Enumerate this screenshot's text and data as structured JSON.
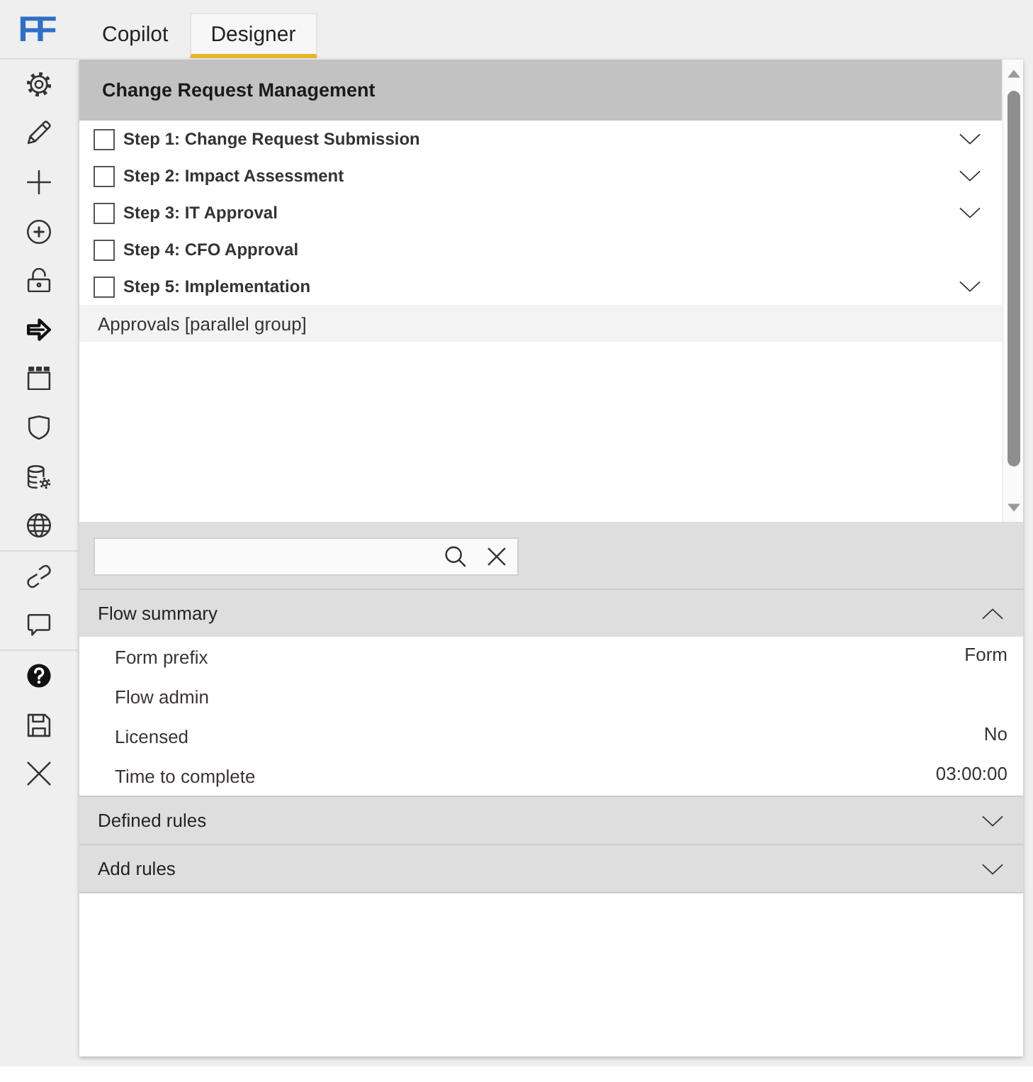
{
  "logo": "FF",
  "sidebar": {
    "groups": [
      {
        "items": [
          {
            "kind": "gear"
          },
          {
            "kind": "pencil"
          },
          {
            "kind": "plus"
          },
          {
            "kind": "plus-circle"
          },
          {
            "kind": "lock"
          },
          {
            "kind": "arrow"
          },
          {
            "kind": "window"
          },
          {
            "kind": "shield"
          },
          {
            "kind": "database"
          },
          {
            "kind": "globe"
          }
        ]
      },
      {
        "items": [
          {
            "kind": "link"
          },
          {
            "kind": "comment"
          }
        ]
      },
      {
        "items": [
          {
            "kind": "help"
          },
          {
            "kind": "save"
          },
          {
            "kind": "close"
          }
        ]
      }
    ]
  },
  "tabs": [
    {
      "label": "Copilot",
      "selected": false
    },
    {
      "label": "Designer",
      "selected": true
    }
  ],
  "flow": {
    "title": "Change Request Management",
    "steps": [
      {
        "label": "Step 1: Change Request Submission",
        "checked": false,
        "expandable": true
      },
      {
        "label": "Step 2: Impact Assessment",
        "checked": false,
        "expandable": true
      },
      {
        "label": "Step 3: IT Approval",
        "checked": false,
        "expandable": true
      },
      {
        "label": "Step 4: CFO Approval",
        "checked": false,
        "expandable": false
      },
      {
        "label": "Step 5: Implementation",
        "checked": false,
        "expandable": true
      }
    ],
    "group": "Approvals [parallel group]"
  },
  "sections": [
    {
      "title": "Flow summary",
      "expanded": true,
      "properties": [
        {
          "label": "Form prefix",
          "value": "Form"
        },
        {
          "label": "Flow admin"
        },
        {
          "label": "Licensed",
          "value": "No"
        },
        {
          "label": "Time to complete",
          "value": "03:00:00"
        }
      ]
    },
    {
      "title": "Defined rules",
      "expanded": false
    },
    {
      "title": "Add rules",
      "expanded": false
    }
  ]
}
